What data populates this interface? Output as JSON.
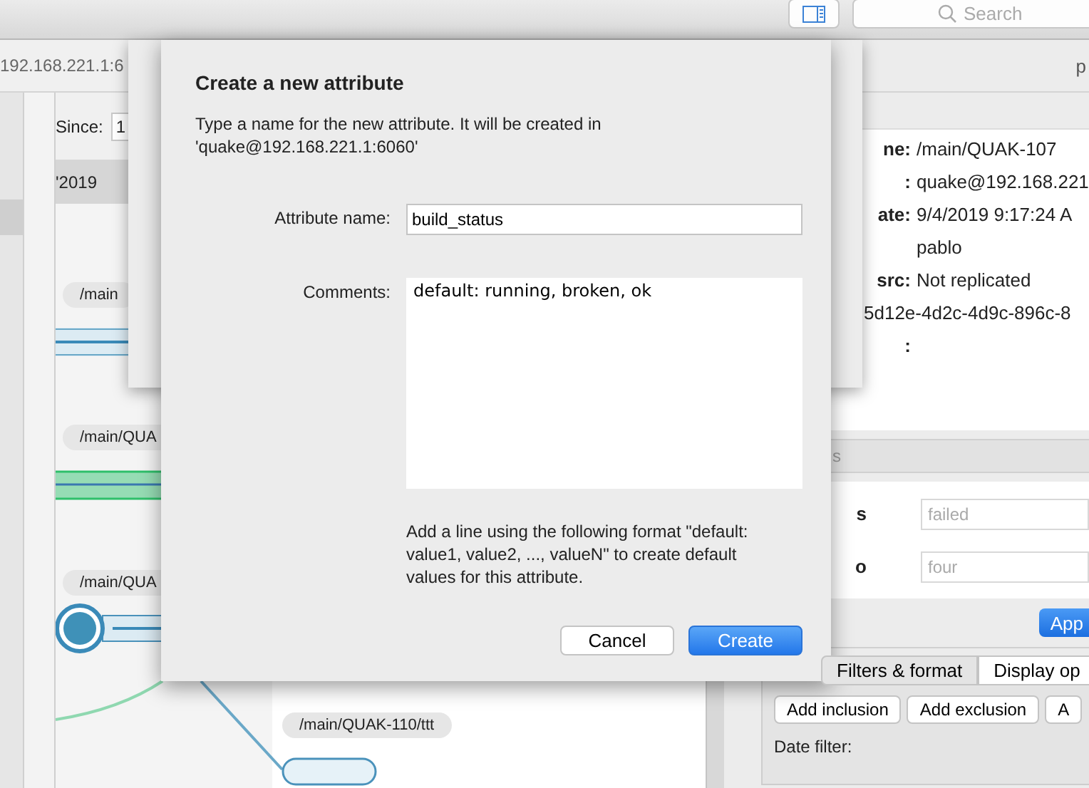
{
  "toolbar": {
    "search": {
      "placeholder": "Search"
    }
  },
  "location": {
    "address": "192.168.221.1:6",
    "right_text": "p"
  },
  "history": {
    "since_label": "Since:",
    "since_value": "1",
    "header_date": "'2019",
    "branches": [
      {
        "label": "/main"
      },
      {
        "label": "/main/QUA"
      },
      {
        "label": "/main/QUA"
      },
      {
        "label": "/main/QUAK-110/ttt"
      }
    ]
  },
  "properties": {
    "rows": [
      {
        "label": "ne:",
        "value": "/main/QUAK-107"
      },
      {
        "label": ":",
        "value": "quake@192.168.221"
      },
      {
        "label": "ate:",
        "value": "9/4/2019 9:17:24 A"
      },
      {
        "value": "pablo"
      },
      {
        "label": "src:",
        "value": "Not replicated"
      },
      {
        "value": "5d12e-4d2c-4d9c-896c-8",
        "kind": "wide"
      },
      {
        "label": ":"
      }
    ]
  },
  "attributes": {
    "header": "s",
    "rows": [
      {
        "label": "s",
        "placeholder": "failed"
      },
      {
        "label": "o",
        "placeholder": "four"
      }
    ],
    "apply": "App"
  },
  "filters": {
    "tabs": [
      {
        "label": "Filters & format",
        "selected": true
      },
      {
        "label": "Display op",
        "selected": false
      }
    ],
    "buttons": [
      "Add inclusion",
      "Add exclusion",
      "A"
    ],
    "date_label": "Date filter:"
  },
  "dialog": {
    "title": "Create a new attribute",
    "message": "Type a name for the new attribute. It will be created in\n'quake@192.168.221.1:6060'",
    "name_label": "Attribute name:",
    "name_value": "build_status",
    "comments_label": "Comments:",
    "comments_value": "default: running, broken, ok",
    "hint": "Add a line using the following format \"default:\nvalue1, value2, ..., valueN\" to create default\nvalues for this attribute.",
    "buttons": [
      {
        "label": "Cancel",
        "kind": "default"
      },
      {
        "label": "Create",
        "kind": "primary"
      }
    ]
  }
}
